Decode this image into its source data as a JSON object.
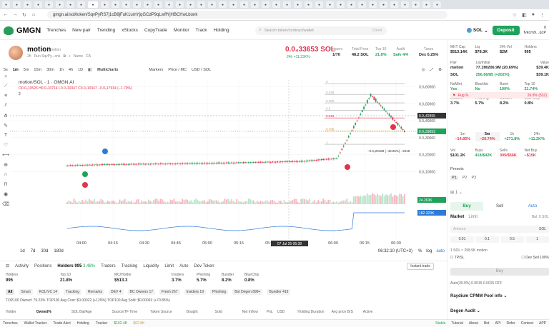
{
  "browser": {
    "url": "gmgn.ai/sol/token/SqvPyRS7j1cB9jFuK1umYjqGCdP9qLwffYjHBCHwLbonk"
  },
  "header": {
    "logo_text": "GMGN",
    "nav": [
      "Trenches",
      "New pair",
      "Trending",
      "xStocks",
      "CopyTrade",
      "Monitor",
      "Track",
      "Holding"
    ],
    "search_placeholder": "Search token/contract/wallet",
    "search_shortcut": "Ctrl+K",
    "chain": "SOL",
    "deposit_label": "Deposit",
    "account_value": "0",
    "account_name": "fvkcm9...qcP"
  },
  "token": {
    "name": "motion",
    "ticker": "motion",
    "age": "2h",
    "creator": "Run SqvPy...onk",
    "meta_items": [
      "Name",
      "CA"
    ],
    "price": "0.0₄33653 SOL",
    "change_24h": "24h +11.23K%",
    "stats": [
      {
        "label": "Snipers",
        "value": "1/70"
      },
      {
        "label": "Total Fees",
        "value": "48.2 SOL"
      },
      {
        "label": "Top 10",
        "value": "21.8%"
      },
      {
        "label": "Audit",
        "value": "Safe 4/4"
      },
      {
        "label": "Taxes",
        "value": "Dex 0.25%"
      }
    ]
  },
  "chart_toolbar": {
    "intervals": [
      "5s",
      "1m",
      "5m",
      "15m",
      "30m",
      "1h",
      "4h",
      "1D"
    ],
    "indicators_label": "Multicharts",
    "markers_label": "Markers",
    "price_toggle": "Price / MC",
    "currency_toggle": "USD / SOL"
  },
  "chart_header": {
    "title": "motion/SOL · 1 · GMGN.AI",
    "ohlc": "O0.0₅10526 H0.0₄10714 L0.0₄10347 C0.0₄10347 −0.0₆17934 (−1.70%)",
    "legend_value": "2"
  },
  "chart_data": {
    "type": "line",
    "title": "motion/SOL · 1 · GMGN.AI",
    "x": [
      "04:00",
      "04:15",
      "04:30",
      "04:45",
      "05:00",
      "05:15",
      "05:30",
      "05:45",
      "06:00",
      "06:15",
      "06:30"
    ],
    "series": [
      {
        "name": "close",
        "values": [
          1.36e-05,
          1.41e-05,
          1.44e-05,
          1.46e-05,
          1.49e-05,
          1.52e-05,
          1.56e-05,
          1.61e-05,
          1.78e-05,
          5.52e-05,
          3.37e-05
        ]
      }
    ],
    "y_ticks": [
      "0.0₄60000",
      "0.0₄50000",
      "0.0₄40000",
      "0.0₄30000",
      "0.0₄20000",
      "0.0₄10000"
    ],
    "ylim": [
      0.0,
      6.4e-05
    ],
    "fib_levels": [
      {
        "label": "0",
        "value": 6.18e-05
      },
      {
        "label": "0.236",
        "value": 5.55e-05
      },
      {
        "label": "0.382",
        "value": 5.05e-05
      },
      {
        "label": "0.5",
        "value": 4.62e-05
      },
      {
        "label": "0.618",
        "value": 4.16e-05
      },
      {
        "label": "0.786",
        "value": 3.4e-05
      },
      {
        "label": "1",
        "value": 2.61e-05
      }
    ],
    "price_tags": [
      {
        "label": "0.0₄42955",
        "color": "#333333"
      },
      {
        "label": "0.0₄33653",
        "color": "#1fa35b"
      },
      {
        "label": "24.263K",
        "color": "#1fa35b"
      },
      {
        "label": "182.323K",
        "color": "#2d7bd6"
      }
    ],
    "annotation": "−0.0₅20488 (−48.96%) −2048",
    "crosshair_time": "07 Jul 25  05:38",
    "grid": true,
    "legend": "top-left"
  },
  "range_bar": {
    "ranges": [
      "1d",
      "7d",
      "30d",
      "180d"
    ],
    "clock": "06:32:10 (UTC+3)",
    "scale_options": [
      "%",
      "log",
      "auto"
    ]
  },
  "bottom_tabs": {
    "tabs": [
      "Activity",
      "Positions",
      "Holders 995",
      "Traders",
      "Tracking",
      "Liquidity",
      "Limit",
      "Auto",
      "Dev Token"
    ],
    "active": "Holders 995",
    "holders_badge": "3.48%",
    "instant_trade_label": "Instant trade"
  },
  "holder_stats": [
    {
      "label": "Holders",
      "value": "995"
    },
    {
      "label": "Top 10",
      "value": "21.8%"
    },
    {
      "label": "MC/Holder",
      "value": "$513.3"
    },
    {
      "label": "Insiders",
      "value": "3.7%"
    },
    {
      "label": "Phishing",
      "value": "5.7%"
    },
    {
      "label": "Bundler",
      "value": "8.2%"
    },
    {
      "label": "BlueChip",
      "value": "0.8%"
    }
  ],
  "filters": [
    "All",
    "Smart",
    "KOL/VC 14",
    "Tracking",
    "Remarks",
    "DEV 4",
    "BC Owners 17",
    "Fresh 267",
    "Insiders 19",
    "Phishing",
    "Bot Degen 899+",
    "Bundler 419"
  ],
  "summary": "TOP100 Owned: 79.23%   TOP100 Avg Cost: $0.00022 (+129%)   TOP100 Avg Sold: $0.00063 (+70.85%)",
  "columns": [
    "Holder",
    "Owned%",
    "SOL Bal/Age",
    "Source/TF Time",
    "Token Source",
    "Bought",
    "Sold",
    "Net Inflow",
    "PnL",
    "USD",
    "Holding Duration",
    "Avg price B/S",
    "Active"
  ],
  "right_panel": {
    "stats_row1": [
      {
        "label": "MKT Cap",
        "value": "$513.14K"
      },
      {
        "label": "Liq",
        "value": "$78.3K"
      },
      {
        "label": "24h Vol",
        "value": "$2M"
      },
      {
        "label": "Holders",
        "value": "995"
      }
    ],
    "pair_row": [
      {
        "label": "Pair",
        "value": "motion"
      },
      {
        "label": "Liq/Initial",
        "value": "77.1M/206.9M (20.69%)"
      },
      {
        "label": "Value",
        "value": "$39.4K"
      }
    ],
    "pair_row2": [
      {
        "label": "",
        "value": "SOL"
      },
      {
        "label": "",
        "value": "256.66/85 (+202%)"
      },
      {
        "label": "",
        "value": "$39.1K"
      }
    ],
    "audit_row": [
      {
        "label": "NoMint",
        "value": "Yes"
      },
      {
        "label": "Blacklist",
        "value": "No"
      },
      {
        "label": "Burnt",
        "value": "100%"
      },
      {
        "label": "Top 10",
        "value": "21.74%"
      }
    ],
    "risk_row": [
      {
        "label": "Insiders",
        "value": "3.7%"
      },
      {
        "label": "Phishing",
        "value": "5.7%"
      },
      {
        "label": "Bundler",
        "value": "8.2%"
      },
      {
        "label": "Blue Chip",
        "value": "0.8%"
      }
    ],
    "bug_label": "Rug %",
    "bug_value": "26.8% (532)",
    "timeframes": [
      {
        "label": "1m",
        "value": "−14.85%"
      },
      {
        "label": "5m",
        "value": "−20.74%"
      },
      {
        "label": "1h",
        "value": "+271.8%"
      },
      {
        "label": "24h",
        "value": "+11.2K%"
      }
    ],
    "vol_row": [
      {
        "label": "Vol",
        "value": "$101.2K"
      },
      {
        "label": "Buys",
        "value": "418/$42K"
      },
      {
        "label": "Sells",
        "value": "305/$56K"
      },
      {
        "label": "Net Buy",
        "value": "−$15K"
      }
    ],
    "presets_label": "Presets",
    "preset_tabs": [
      "P1",
      "P2",
      "P3"
    ],
    "buy_label": "Buy",
    "sell_label": "Sell",
    "auto_label": "Auto",
    "order_types": [
      "Market",
      "Limit"
    ],
    "balance": "Bal: 0 SOL",
    "amount_placeholder": "Amount",
    "amount_unit": "SOL",
    "amount_presets": [
      "0.01",
      "0.1",
      "0.5",
      "1"
    ],
    "conversion": "1 SOL ≈ 298.5K motion",
    "tpsl_label": "TP/SL",
    "dev_sell_label": "Dev Sell 100%",
    "buy_button": "Buy",
    "settings_row": "Auto(30.0%)  0.0015  0.0015  OFF",
    "raydium_label": "Raydium CPMM Pool info",
    "degen_label": "Degen Audit"
  },
  "statusbar": {
    "items": [
      "Trenches",
      "Wallet Tracker",
      "Trade Alert",
      "Holding",
      "Tracker"
    ],
    "sol_price": "$152.48",
    "btc_price": "$62.8K",
    "right_items": [
      "Stable",
      "Tutorial",
      "About",
      "Bot",
      "API",
      "Refer",
      "Contest",
      "APP"
    ]
  }
}
